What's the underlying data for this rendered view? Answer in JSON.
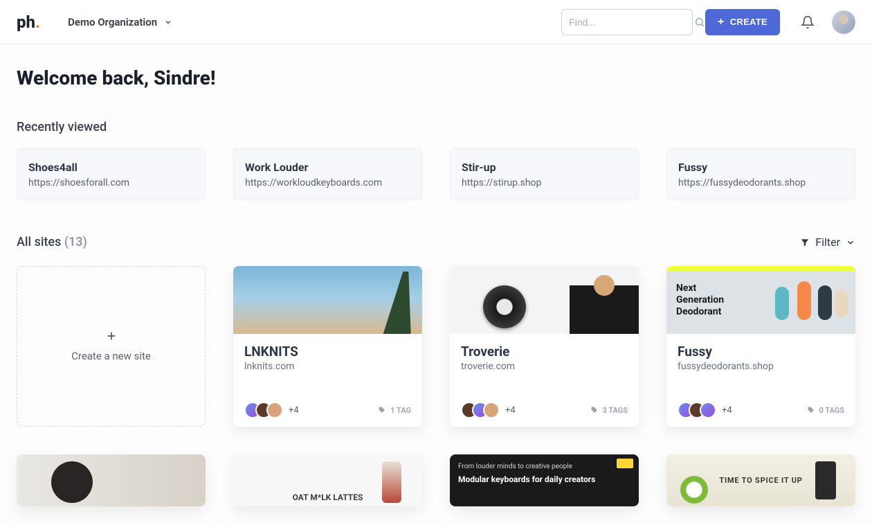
{
  "header": {
    "logo_text": "ph",
    "logo_dot": ".",
    "org_name": "Demo Organization",
    "search_placeholder": "Find...",
    "create_label": "CREATE"
  },
  "main": {
    "welcome": "Welcome back, Sindre!",
    "recent_title": "Recently viewed",
    "recent": [
      {
        "title": "Shoes4all",
        "url": "https://shoesforall.com"
      },
      {
        "title": "Work Louder",
        "url": "https://workloudkeyboards.com"
      },
      {
        "title": "Stir-up",
        "url": "https://stirup.shop"
      },
      {
        "title": "Fussy",
        "url": "https://fussydeodorants.shop"
      }
    ],
    "all_sites_label": "All sites",
    "all_sites_count": "(13)",
    "filter_label": "Filter",
    "new_site_label": "Create a new site",
    "sites": [
      {
        "name": "LNKNITS",
        "url": "lnknits.com",
        "more": "+4",
        "tags": "1 TAG"
      },
      {
        "name": "Troverie",
        "url": "troverie.com",
        "more": "+4",
        "tags": "3 TAGS"
      },
      {
        "name": "Fussy",
        "url": "fussydeodorants.shop",
        "more": "+4",
        "tags": "0 TAGS"
      }
    ],
    "fussy_thumb_text": "Next Generation Deodorant",
    "row2": {
      "oat_text": "OAT M*LK LATTES",
      "dark_line1": "From louder minds to creative people",
      "dark_line2": "Modular keyboards for daily creators",
      "stir_text": "TIME TO SPICE IT UP"
    }
  }
}
